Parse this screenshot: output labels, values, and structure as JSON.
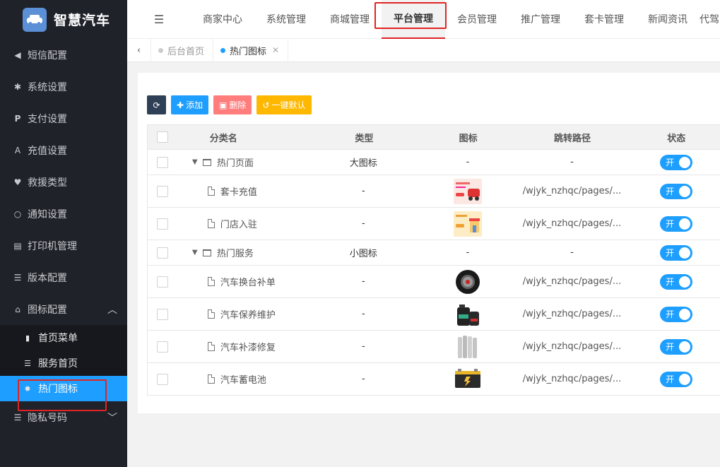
{
  "app": {
    "logo_text": "智慧汽车"
  },
  "sidebar": {
    "items": [
      {
        "label": "短信配置",
        "icon": "megaphone-icon"
      },
      {
        "label": "系统设置",
        "icon": "gear-icon"
      },
      {
        "label": "支付设置",
        "icon": "paypal-icon"
      },
      {
        "label": "充值设置",
        "icon": "recharge-icon"
      },
      {
        "label": "救援类型",
        "icon": "heart-icon"
      },
      {
        "label": "通知设置",
        "icon": "circle-icon"
      },
      {
        "label": "打印机管理",
        "icon": "printer-icon"
      },
      {
        "label": "版本配置",
        "icon": "list-icon"
      },
      {
        "label": "图标配置",
        "icon": "bank-icon"
      }
    ],
    "submenu": [
      {
        "label": "首页菜单",
        "icon": "bookmark-icon"
      },
      {
        "label": "服务首页",
        "icon": "list-icon"
      },
      {
        "label": "热门图标",
        "icon": "sun-icon"
      }
    ],
    "last_item": {
      "label": "隐私号码",
      "icon": "list-icon"
    }
  },
  "topnav": {
    "items": [
      "商家中心",
      "系统管理",
      "商城管理",
      "平台管理",
      "会员管理",
      "推广管理",
      "套卡管理",
      "新闻资讯",
      "代驾"
    ]
  },
  "tabs": [
    {
      "label": "后台首页"
    },
    {
      "label": "热门图标"
    }
  ],
  "toolbar": {
    "add_label": "添加",
    "delete_label": "删除",
    "default_label": "一键默认"
  },
  "table": {
    "headers": [
      "分类名",
      "类型",
      "图标",
      "跳转路径",
      "状态"
    ],
    "rows": [
      {
        "name": "热门页面",
        "type": "大图标",
        "icon": "-",
        "path": "-",
        "status": "开",
        "kind": "parent"
      },
      {
        "name": "套卡充值",
        "type": "-",
        "icon": "card-recharge-thumb",
        "path": "/wjyk_nzhqc/pages/...",
        "status": "开",
        "kind": "child"
      },
      {
        "name": "门店入驻",
        "type": "-",
        "icon": "store-thumb",
        "path": "/wjyk_nzhqc/pages/...",
        "status": "开",
        "kind": "child"
      },
      {
        "name": "热门服务",
        "type": "小图标",
        "icon": "-",
        "path": "-",
        "status": "开",
        "kind": "parent"
      },
      {
        "name": "汽车换台补单",
        "type": "-",
        "icon": "tire-thumb",
        "path": "/wjyk_nzhqc/pages/...",
        "status": "开",
        "kind": "child"
      },
      {
        "name": "汽车保养维护",
        "type": "-",
        "icon": "oil-thumb",
        "path": "/wjyk_nzhqc/pages/...",
        "status": "开",
        "kind": "child"
      },
      {
        "name": "汽车补漆修复",
        "type": "-",
        "icon": "paint-thumb",
        "path": "/wjyk_nzhqc/pages/...",
        "status": "开",
        "kind": "child"
      },
      {
        "name": "汽车蓄电池",
        "type": "-",
        "icon": "battery-thumb",
        "path": "/wjyk_nzhqc/pages/...",
        "status": "开",
        "kind": "child"
      }
    ]
  },
  "colors": {
    "accent": "#1e9fff",
    "sidebar_bg": "#20222a",
    "highlight": "#e02424"
  }
}
